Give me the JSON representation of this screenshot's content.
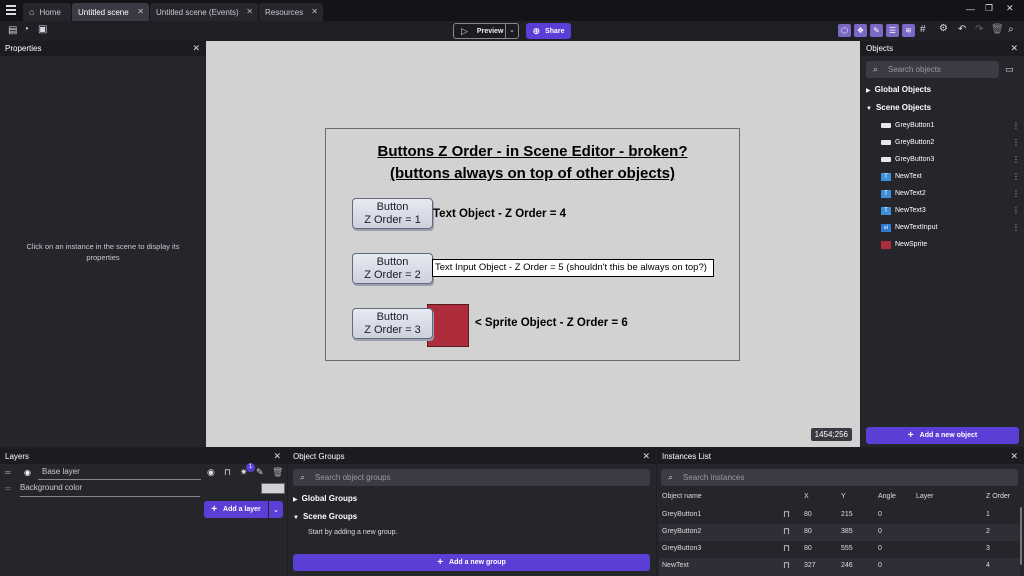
{
  "tabs": [
    {
      "label": "Home"
    },
    {
      "label": "Untitled scene"
    },
    {
      "label": "Untitled scene (Events)"
    },
    {
      "label": "Resources"
    }
  ],
  "toolbar": {
    "preview_label": "Preview",
    "share_label": "Share"
  },
  "properties": {
    "title": "Properties",
    "hint": "Click on an instance in the scene to display its properties"
  },
  "scene": {
    "title_line1": "Buttons Z Order - in Scene Editor - broken?",
    "title_line2": "(buttons always on top of other objects)",
    "buttons": [
      {
        "line1": "Button",
        "line2": "Z Order = 1"
      },
      {
        "line1": "Button",
        "line2": "Z Order = 2"
      },
      {
        "line1": "Button",
        "line2": "Z Order = 3"
      }
    ],
    "text1": "Text Object - Z Order = 4",
    "text_input": "Text Input Object - Z Order = 5 (shouldn't this be always on top?)",
    "sprite_text": "< Sprite Object - Z Order = 6",
    "cursor_coords": "1454;256"
  },
  "objects": {
    "title": "Objects",
    "search_placeholder": "Search objects",
    "global_label": "Global Objects",
    "scene_label": "Scene Objects",
    "items": [
      {
        "name": "GreyButton1",
        "icon": "button-icon"
      },
      {
        "name": "GreyButton2",
        "icon": "button-icon"
      },
      {
        "name": "GreyButton3",
        "icon": "button-icon"
      },
      {
        "name": "NewText",
        "icon": "text-icon"
      },
      {
        "name": "NewText2",
        "icon": "text-icon"
      },
      {
        "name": "NewText3",
        "icon": "text-icon"
      },
      {
        "name": "NewTextInput",
        "icon": "text-input-icon"
      },
      {
        "name": "NewSprite",
        "icon": "sprite-icon"
      }
    ],
    "add_label": "Add a new object"
  },
  "layers": {
    "title": "Layers",
    "base_layer": "Base layer",
    "badge": "1",
    "background_label": "Background color",
    "add_label": "Add a layer"
  },
  "groups": {
    "title": "Object Groups",
    "search_placeholder": "Search object groups",
    "global_label": "Global Groups",
    "scene_label": "Scene Groups",
    "empty_hint": "Start by adding a new group.",
    "add_label": "Add a new group"
  },
  "instances": {
    "title": "Instances List",
    "search_placeholder": "Search instances",
    "columns": [
      "Object name",
      "X",
      "Y",
      "Angle",
      "Layer",
      "Z Order"
    ],
    "rows": [
      {
        "name": "GreyButton1",
        "x": "80",
        "y": "215",
        "angle": "0",
        "layer": "",
        "z": "1"
      },
      {
        "name": "GreyButton2",
        "x": "80",
        "y": "385",
        "angle": "0",
        "layer": "",
        "z": "2"
      },
      {
        "name": "GreyButton3",
        "x": "80",
        "y": "555",
        "angle": "0",
        "layer": "",
        "z": "3"
      },
      {
        "name": "NewText",
        "x": "327",
        "y": "246",
        "angle": "0",
        "layer": "",
        "z": "4"
      }
    ]
  },
  "colors": {
    "accent": "#5a3ed6",
    "sprite": "#ad2d3c",
    "canvas": "#d2d2d2"
  }
}
